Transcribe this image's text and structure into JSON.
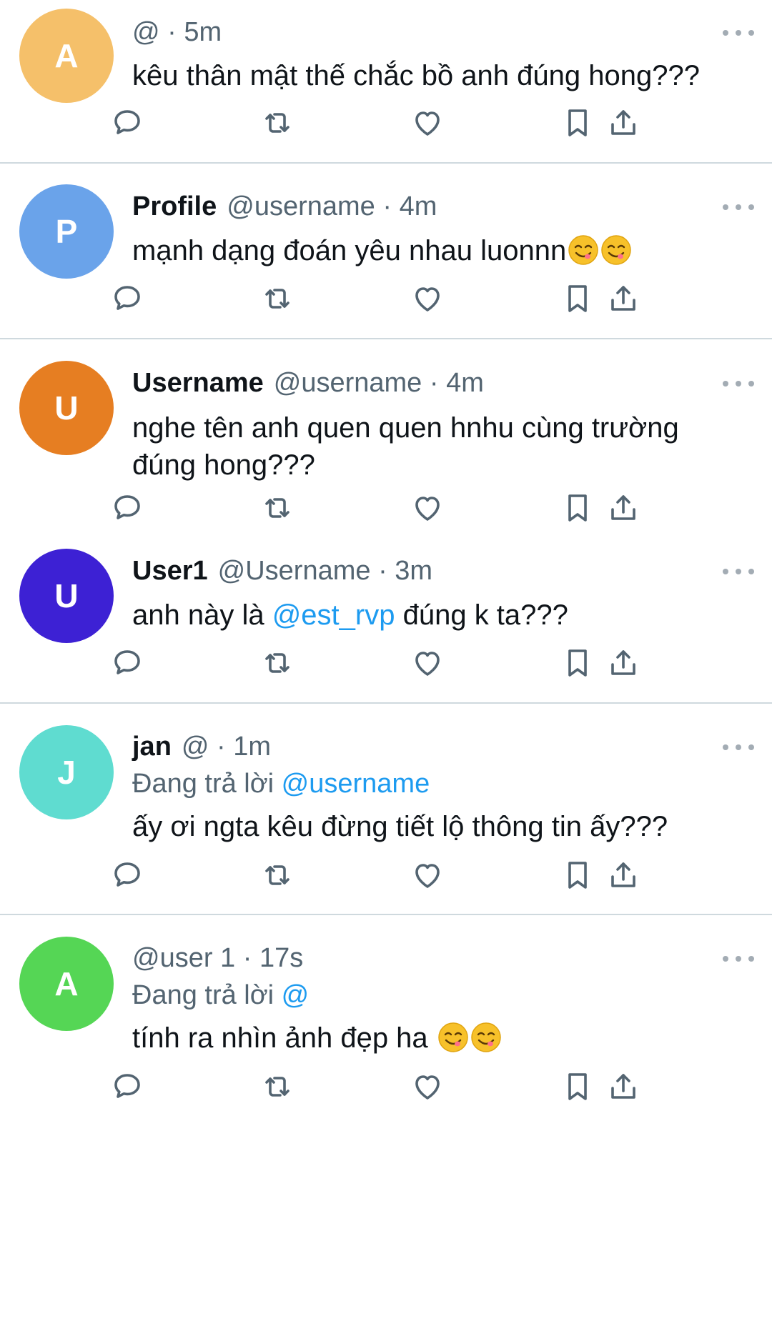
{
  "tweets": [
    {
      "avatar_letter": "A",
      "avatar_color": "#f5c06a",
      "name": "",
      "handle": "@",
      "time": "5m",
      "reply_prefix": "",
      "reply_handle": "",
      "text_before": "kêu thân mật thế chắc bồ anh đúng hong???",
      "mention": "",
      "text_after": "",
      "emoji_count": 0
    },
    {
      "avatar_letter": "P",
      "avatar_color": "#6aa3ea",
      "name": "Profile",
      "handle": "@username",
      "time": "4m",
      "reply_prefix": "",
      "reply_handle": "",
      "text_before": "mạnh dạng đoán yêu nhau luonnn",
      "mention": "",
      "text_after": "",
      "emoji_count": 2
    },
    {
      "avatar_letter": "U",
      "avatar_color": "#e67e22",
      "name": "Username",
      "handle": "@username",
      "time": "4m",
      "reply_prefix": "",
      "reply_handle": "",
      "text_before": "nghe tên anh quen quen hnhu cùng trường đúng hong???",
      "mention": "",
      "text_after": "",
      "emoji_count": 0
    },
    {
      "avatar_letter": "U",
      "avatar_color": "#3d21d4",
      "name": "User1",
      "handle": "@Username",
      "time": "3m",
      "reply_prefix": "",
      "reply_handle": "",
      "text_before": "anh này là ",
      "mention": "@est_rvp",
      "text_after": " đúng k ta???",
      "emoji_count": 0
    },
    {
      "avatar_letter": "J",
      "avatar_color": "#5fdcd0",
      "name": "jan",
      "handle": "@",
      "time": "1m",
      "reply_prefix": "Đang trả lời",
      "reply_handle": "@username",
      "text_before": "ấy ơi ngta kêu đừng tiết lộ thông tin ấy???",
      "mention": "",
      "text_after": "",
      "emoji_count": 0
    },
    {
      "avatar_letter": "A",
      "avatar_color": "#55d655",
      "name": "",
      "handle": "@user 1",
      "time": "17s",
      "reply_prefix": "Đang trả lời",
      "reply_handle": "@",
      "text_before": "tính ra nhìn ảnh đẹp ha ",
      "mention": "",
      "text_after": "",
      "emoji_count": 2
    }
  ],
  "separator": "·",
  "icons": [
    "reply-icon",
    "retweet-icon",
    "like-icon",
    "bookmark-icon",
    "share-icon",
    "more-icon"
  ]
}
